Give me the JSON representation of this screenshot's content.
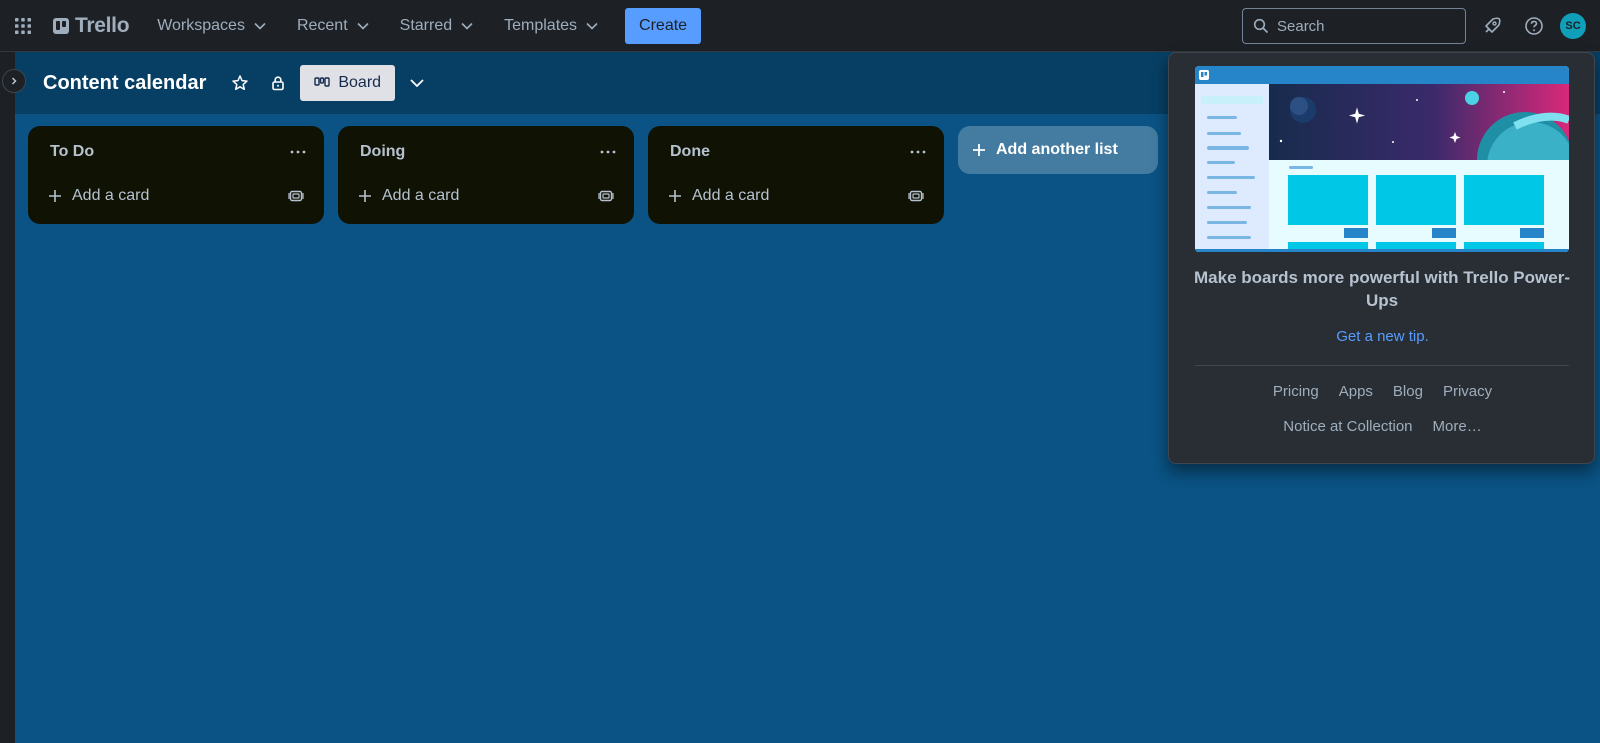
{
  "app": {
    "name": "Trello"
  },
  "topnav": {
    "items": [
      {
        "label": "Workspaces",
        "icon": "chevron-down-icon"
      },
      {
        "label": "Recent",
        "icon": "chevron-down-icon"
      },
      {
        "label": "Starred",
        "icon": "chevron-down-icon"
      },
      {
        "label": "Templates",
        "icon": "chevron-down-icon"
      }
    ],
    "create_label": "Create",
    "search_placeholder": "Search",
    "avatar_initials": "SC"
  },
  "board": {
    "title": "Content calendar",
    "view_label": "Board",
    "background_color": "#0a5384",
    "lists": [
      {
        "title": "To Do",
        "add_card_label": "Add a card"
      },
      {
        "title": "Doing",
        "add_card_label": "Add a card"
      },
      {
        "title": "Done",
        "add_card_label": "Add a card"
      }
    ],
    "add_list_label": "Add another list"
  },
  "popover": {
    "tip_title": "Make boards more powerful with Trello Power-Ups",
    "tip_link": "Get a new tip.",
    "links": [
      "Pricing",
      "Apps",
      "Blog",
      "Privacy",
      "Notice at Collection",
      "More…"
    ]
  },
  "colors": {
    "accent": "#579dff",
    "header_bg": "#1d2125",
    "list_bg": "#101204",
    "avatar": "#0f9fb8"
  }
}
